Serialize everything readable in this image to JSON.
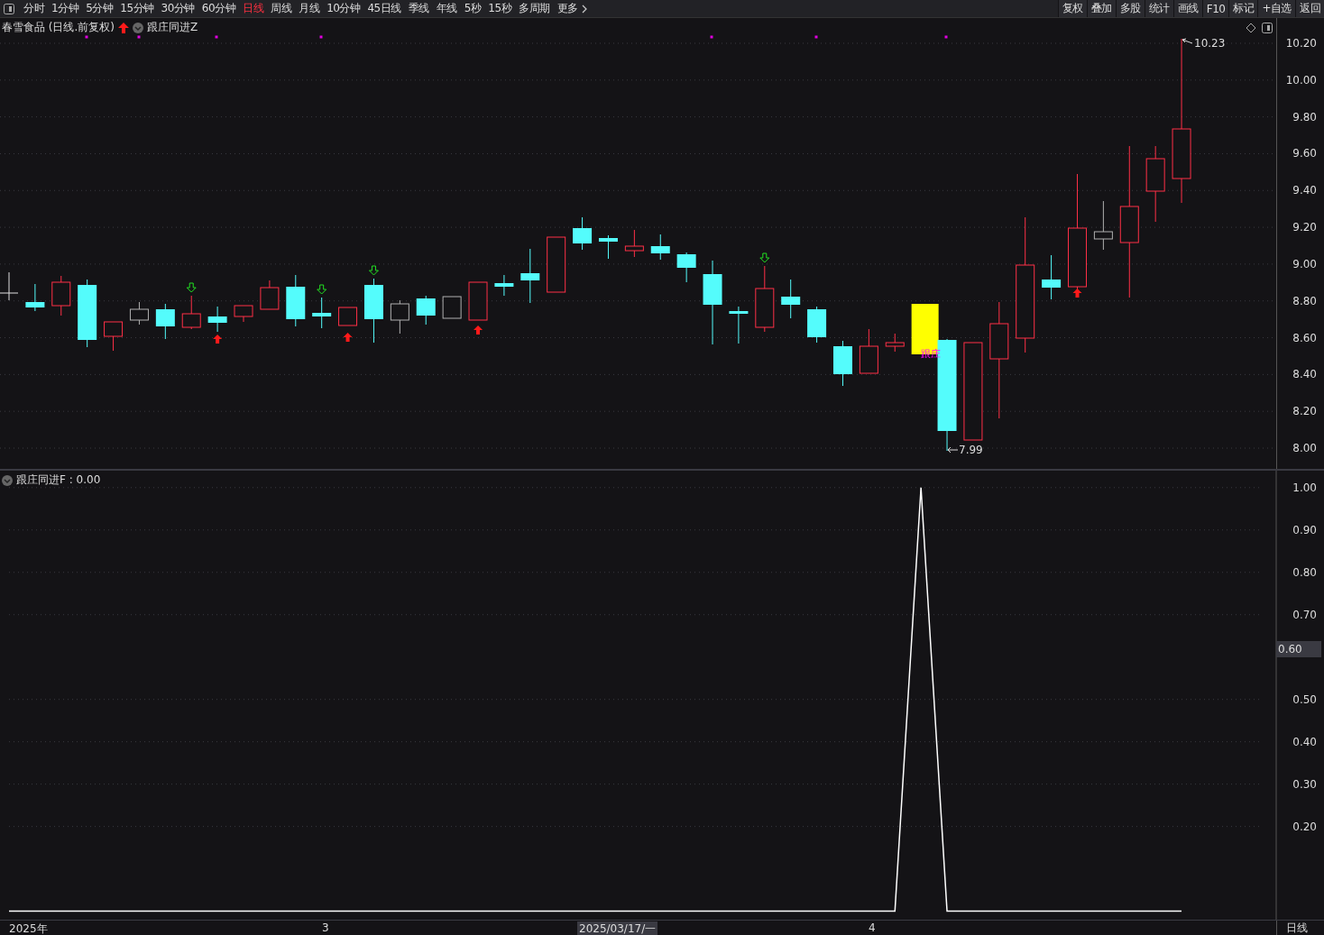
{
  "toolbar": {
    "periods": [
      {
        "label": "分时",
        "selected": false
      },
      {
        "label": "1分钟",
        "selected": false
      },
      {
        "label": "5分钟",
        "selected": false
      },
      {
        "label": "15分钟",
        "selected": false
      },
      {
        "label": "30分钟",
        "selected": false
      },
      {
        "label": "60分钟",
        "selected": false
      },
      {
        "label": "日线",
        "selected": true
      },
      {
        "label": "周线",
        "selected": false
      },
      {
        "label": "月线",
        "selected": false
      },
      {
        "label": "10分钟",
        "selected": false
      },
      {
        "label": "45日线",
        "selected": false
      },
      {
        "label": "季线",
        "selected": false
      },
      {
        "label": "年线",
        "selected": false
      },
      {
        "label": "5秒",
        "selected": false
      },
      {
        "label": "15秒",
        "selected": false
      },
      {
        "label": "多周期",
        "selected": false
      },
      {
        "label": "更多",
        "selected": false
      }
    ],
    "tools": [
      "复权",
      "叠加",
      "多股",
      "统计",
      "画线",
      "F10",
      "标记",
      "+自选",
      "返回"
    ]
  },
  "price_panel": {
    "stock_title": "春雪食品 (日线.前复权)",
    "indicator_name": "跟庄同进Z",
    "axis_labels": [
      "10.20",
      "10.00",
      "9.80",
      "9.60",
      "9.40",
      "9.20",
      "9.00",
      "8.80",
      "8.60",
      "8.40",
      "8.20",
      "8.00"
    ],
    "high_label": "10.23",
    "low_label": "7.99",
    "signal_label": "跟庄"
  },
  "indicator_panel": {
    "title": "跟庄同进F : 0.00",
    "cursor_readout": "0.60",
    "chart_data": {
      "type": "line",
      "values": [
        0,
        0,
        0,
        0,
        0,
        0,
        0,
        0,
        0,
        0,
        0,
        0,
        0,
        0,
        0,
        0,
        0,
        0,
        0,
        0,
        0,
        0,
        0,
        0,
        0,
        0,
        0,
        0,
        0,
        0,
        0,
        0,
        0,
        0,
        0,
        1,
        0,
        0,
        0,
        0,
        0,
        0,
        0,
        0,
        0,
        0,
        null,
        null,
        null
      ],
      "ylim": [
        -0.02,
        1.04
      ],
      "grid": true,
      "yticks": [
        {
          "value": 0.2,
          "label": "0.20"
        },
        {
          "value": 0.3,
          "label": "0.30"
        },
        {
          "value": 0.4,
          "label": "0.40"
        },
        {
          "value": 0.5,
          "label": "0.50"
        },
        {
          "value": 0.7,
          "label": "0.70"
        },
        {
          "value": 0.8,
          "label": "0.80"
        },
        {
          "value": 0.9,
          "label": "0.90"
        },
        {
          "value": 1,
          "label": "1.00"
        }
      ]
    }
  },
  "time_axis": {
    "labels": [
      {
        "label": "2025年",
        "kind": "tick"
      },
      {
        "label": "3",
        "kind": "tick"
      },
      {
        "label": "2025/03/17/一",
        "kind": "cursor"
      },
      {
        "label": "4",
        "kind": "tick"
      }
    ],
    "period_label": "日线"
  }
}
